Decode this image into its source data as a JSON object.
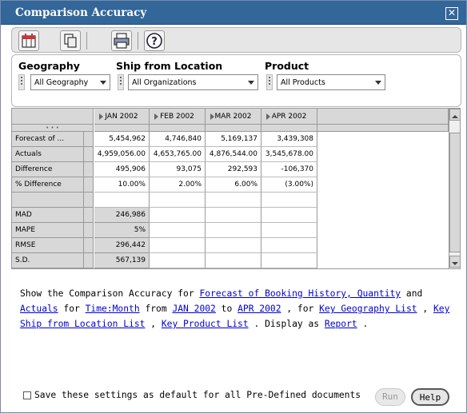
{
  "window": {
    "title": "Comparison Accuracy",
    "close_glyph": "✕"
  },
  "toolbar": {
    "buttons": [
      {
        "icon": "calendar-icon"
      },
      {
        "icon": "copy-icon"
      },
      {
        "icon": "print-icon"
      },
      {
        "icon": "help-icon",
        "glyph": "?"
      }
    ]
  },
  "params": {
    "geography": {
      "label": "Geography",
      "value": "All Geography"
    },
    "ship_from": {
      "label": "Ship from Location",
      "value": "All Organizations"
    },
    "product": {
      "label": "Product",
      "value": "All Products"
    }
  },
  "grid": {
    "columns": [
      "JAN 2002",
      "FEB 2002",
      "MAR 2002",
      "APR 2002"
    ],
    "row_grip": "• • •",
    "rows": [
      {
        "label": "Forecast of ...",
        "values": [
          "5,454,962",
          "4,746,840",
          "5,169,137",
          "3,439,308"
        ]
      },
      {
        "label": "Actuals",
        "values": [
          "4,959,056.00",
          "4,653,765.00",
          "4,876,544.00",
          "3,545,678.00"
        ]
      },
      {
        "label": "Difference",
        "values": [
          "495,906",
          "93,075",
          "292,593",
          "-106,370"
        ]
      },
      {
        "label": "% Difference",
        "values": [
          "10.00%",
          "2.00%",
          "6.00%",
          "(3.00%)"
        ]
      },
      {
        "label": "",
        "values": [
          "",
          "",
          "",
          ""
        ]
      },
      {
        "label": "MAD",
        "values": [
          "246,986",
          "",
          "",
          ""
        ]
      },
      {
        "label": "MAPE",
        "values": [
          "5%",
          "",
          "",
          ""
        ]
      },
      {
        "label": "RMSE",
        "values": [
          "296,442",
          "",
          "",
          ""
        ]
      },
      {
        "label": "S.D.",
        "values": [
          "567,139",
          "",
          "",
          ""
        ]
      }
    ]
  },
  "sentence": {
    "t1": "Show the Comparison Accuracy for ",
    "l1": "Forecast of Booking History, Quantity",
    "t2": " and ",
    "l2": "Actuals",
    "t3": " for ",
    "l3": "Time:Month",
    "t4": " from ",
    "l4": "JAN 2002",
    "t5": " to ",
    "l5": "APR 2002",
    "t6": " , for ",
    "l6": "Key Geography List",
    "t7": " , ",
    "l7": "Key Ship from Location List",
    "t8": " , ",
    "l8": "Key Product List",
    "t9": " . Display as ",
    "l9": "Report",
    "t10": " ."
  },
  "footer": {
    "save_label": "Save these settings as default for all Pre-Defined documents",
    "run_label": "Run",
    "help_label": "Help"
  }
}
